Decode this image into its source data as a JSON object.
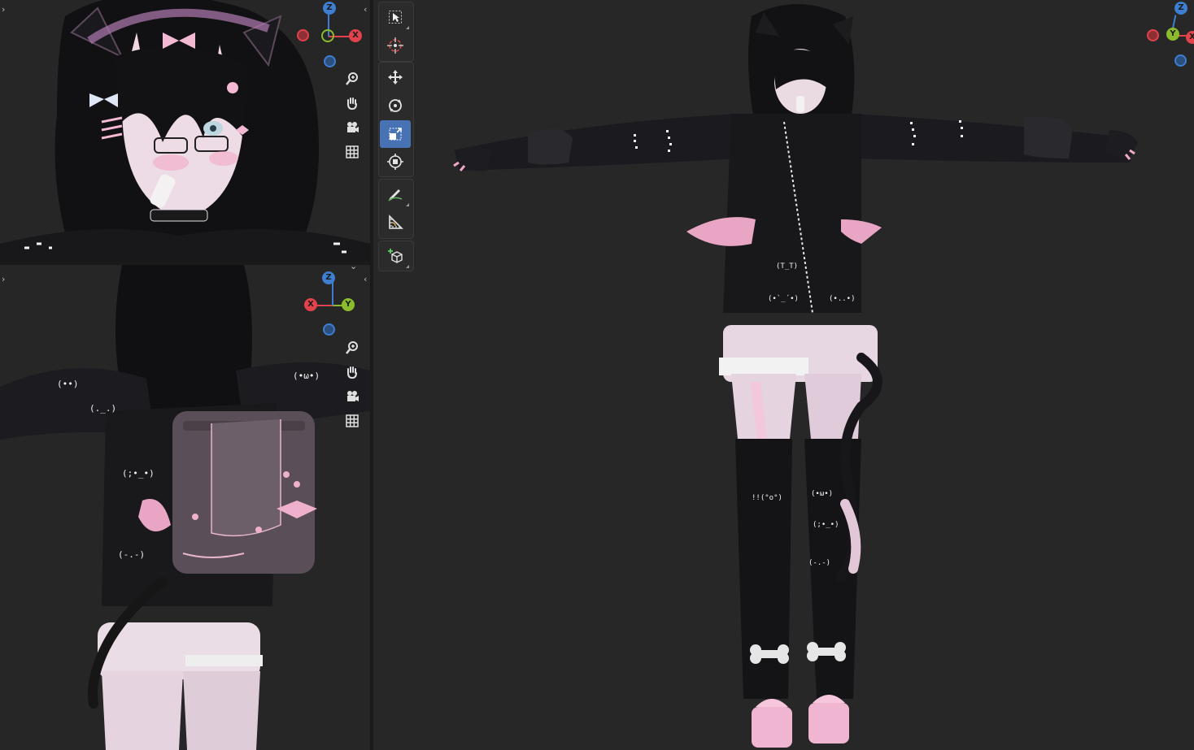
{
  "app": {
    "name": "Blender 3D Viewport",
    "layout": "three viewports"
  },
  "colors": {
    "viewport_bg": "#262626",
    "x_axis": "#e2424b",
    "y_axis": "#8bbd2b",
    "z_axis": "#3d7ed0",
    "active_tool": "#4772b3",
    "character_top": "#1a1a1c",
    "character_skin": "#e8d6e1",
    "accent_pink": "#e9a6c4"
  },
  "viewports": {
    "top": {
      "gizmo": {
        "up": "Z",
        "right": "X",
        "center_axis": "Y",
        "left_negative_axis": "X",
        "down_negative_axis": "Z"
      },
      "nav_icons": [
        "zoom-icon",
        "pan-hand-icon",
        "camera-icon",
        "grid-icon"
      ]
    },
    "bottom": {
      "gizmo": {
        "up": "Z",
        "left": "X",
        "right": "Y",
        "down_negative_axis": "Z"
      },
      "nav_icons": [
        "zoom-icon",
        "pan-hand-icon",
        "camera-icon",
        "grid-icon"
      ]
    },
    "main": {
      "gizmo": {
        "up": "Z",
        "center": "Y",
        "right": "X",
        "left_negative_axis": "X",
        "down_negative_axis": "Z"
      }
    }
  },
  "toolbar": {
    "tools": [
      {
        "name": "select-box",
        "icon": "cursor-arrow-icon",
        "active": false
      },
      {
        "name": "cursor",
        "icon": "crosshair-icon",
        "active": false
      },
      {
        "name": "move",
        "icon": "move-arrows-icon",
        "active": false
      },
      {
        "name": "rotate",
        "icon": "rotate-icon",
        "active": false
      },
      {
        "name": "scale",
        "icon": "scale-icon",
        "active": true
      },
      {
        "name": "transform",
        "icon": "transform-icon",
        "active": false
      },
      {
        "name": "annotate",
        "icon": "pencil-icon",
        "active": false
      },
      {
        "name": "measure",
        "icon": "ruler-icon",
        "active": false
      },
      {
        "name": "add-cube",
        "icon": "add-cube-icon",
        "active": false
      }
    ]
  },
  "character": {
    "sleeve_text_marks": [
      "(T_T)",
      "(•`_´•)",
      "(;•_•)",
      "(•ω•)",
      "(._.)",
      "!!(°o°)",
      "(-.-)"
    ]
  }
}
